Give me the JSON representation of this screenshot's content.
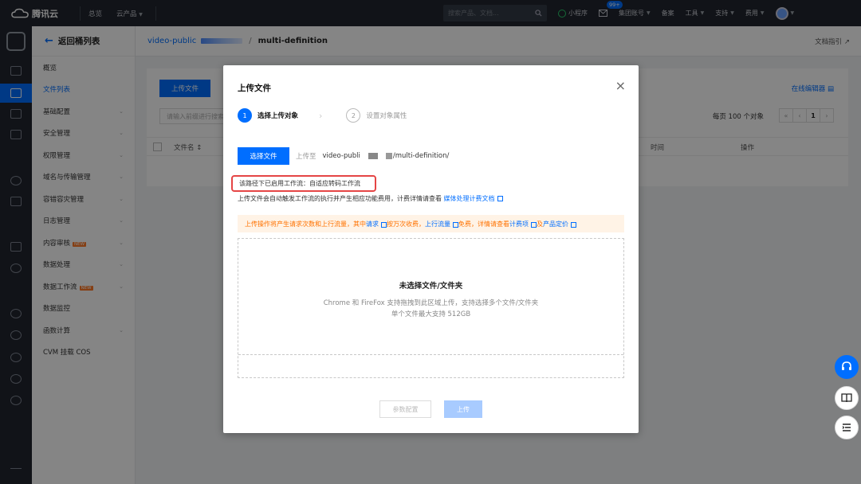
{
  "topbar": {
    "brand": "腾讯云",
    "nav_overview": "总览",
    "nav_products": "云产品",
    "search_placeholder": "搜索产品、文档...",
    "mini_program": "小程序",
    "msg_badge": "99+",
    "group_account": "集团账号",
    "beian": "备案",
    "tools": "工具",
    "support": "支持",
    "billing": "费用"
  },
  "sidebar": {
    "back_label": "返回桶列表",
    "items": [
      {
        "label": "概览",
        "expandable": false
      },
      {
        "label": "文件列表",
        "expandable": false,
        "active": true
      },
      {
        "label": "基础配置",
        "expandable": true
      },
      {
        "label": "安全管理",
        "expandable": true
      },
      {
        "label": "权限管理",
        "expandable": true
      },
      {
        "label": "域名与传输管理",
        "expandable": true
      },
      {
        "label": "容错容灾管理",
        "expandable": true
      },
      {
        "label": "日志管理",
        "expandable": true
      },
      {
        "label": "内容审核",
        "expandable": true,
        "tag": "NEW"
      },
      {
        "label": "数据处理",
        "expandable": true
      },
      {
        "label": "数据工作流",
        "expandable": true,
        "tag": "NEW"
      },
      {
        "label": "数据监控",
        "expandable": false
      },
      {
        "label": "函数计算",
        "expandable": true
      },
      {
        "label": "CVM 挂载 COS",
        "expandable": false
      }
    ]
  },
  "breadcrumb": {
    "bucket": "video-public",
    "separator": "/",
    "path": "multi-definition",
    "doc_link": "文档指引"
  },
  "panel": {
    "upload_button": "上传文件",
    "search_placeholder": "请输入前缀进行搜索",
    "online_editor": "在线编辑器",
    "per_page": "每页 100 个对象",
    "pager": [
      "«",
      "‹",
      "1",
      "›"
    ],
    "col_filename": "文件名 ↕",
    "col_time": "时间",
    "col_actions": "操作"
  },
  "dialog": {
    "title": "上传文件",
    "close": "×",
    "steps": [
      {
        "num": "1",
        "label": "选择上传对象",
        "active": true
      },
      {
        "num": "2",
        "label": "设置对象属性",
        "active": false
      }
    ],
    "select_button": "选择文件",
    "upload_to": "上传至",
    "dest_bucket": "video-publi",
    "dest_path": "/multi-definition/",
    "workflow_notice": "该路径下已启用工作流：自适应转码工作流",
    "workflow_desc": "上传文件会自动触发工作流的执行并产生相应功能费用，计费详情请查看",
    "workflow_doc_link": "媒体处理计费文档",
    "warning": {
      "t1": "上传操作将产生请求次数和上行流量，其中",
      "l1": "请求",
      "t2": "按万次收费，",
      "l2": "上行流量",
      "t3": "免费，详情请查看",
      "l3": "计费项",
      "t4": "及",
      "l4": "产品定价"
    },
    "drop_title": "未选择文件/文件夹",
    "drop_desc1": "Chrome 和 FireFox 支持拖拽到此区域上传，支持选择多个文件/文件夹",
    "drop_desc2": "单个文件最大支持 512GB",
    "param_config_button": "参数配置",
    "upload_button": "上传"
  },
  "colors": {
    "primary": "#006eff",
    "topbar_bg": "#21262f",
    "warning_bg": "#fff3e6",
    "warning_text": "#ff7200",
    "highlight_border": "#e54545"
  }
}
